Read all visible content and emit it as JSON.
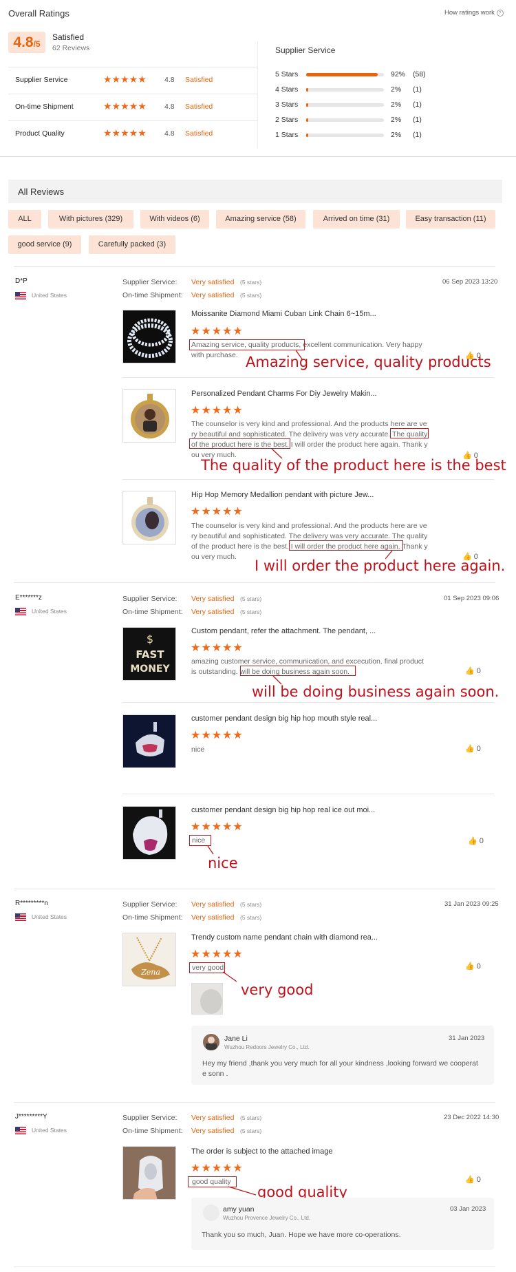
{
  "header": {
    "title": "Overall Ratings",
    "how_link": "How ratings work"
  },
  "overall": {
    "score": "4.8",
    "denom": "/5",
    "label": "Satisfied",
    "reviews": "62 Reviews"
  },
  "categories": [
    {
      "name": "Supplier Service",
      "score": "4.8",
      "label": "Satisfied"
    },
    {
      "name": "On-time Shipment",
      "score": "4.8",
      "label": "Satisfied"
    },
    {
      "name": "Product Quality",
      "score": "4.8",
      "label": "Satisfied"
    }
  ],
  "breakdown": {
    "title": "Supplier Service",
    "rows": [
      {
        "label": "5 Stars",
        "pct": "92%",
        "count": "(58)",
        "fill": 0.92
      },
      {
        "label": "4 Stars",
        "pct": "2%",
        "count": "(1)",
        "fill": 0.02
      },
      {
        "label": "3 Stars",
        "pct": "2%",
        "count": "(1)",
        "fill": 0.02
      },
      {
        "label": "2 Stars",
        "pct": "2%",
        "count": "(1)",
        "fill": 0.02
      },
      {
        "label": "1 Stars",
        "pct": "2%",
        "count": "(1)",
        "fill": 0.02
      }
    ]
  },
  "all_reviews": {
    "title": "All Reviews"
  },
  "filters": [
    "ALL",
    "With pictures (329)",
    "With videos (6)",
    "Amazing service (58)",
    "Arrived on time (31)",
    "Easy transaction (11)",
    "good service (9)",
    "Carefully packed (3)"
  ],
  "labels": {
    "supplier": "Supplier Service:",
    "ontime": "On-time Shipment:",
    "very_satisfied": "Very satisfied",
    "five_stars": "(5 stars)",
    "stars": "★★★★★"
  },
  "reviews": [
    {
      "user": "D*P",
      "country": "United States",
      "date": "06 Sep 2023 13:20"
    },
    {
      "user": "E*******z",
      "country": "United States",
      "date": "01 Sep 2023 09:06"
    },
    {
      "user": "R*********n",
      "country": "United States",
      "date": "31 Jan 2023 09:25"
    },
    {
      "user": "J*********Y",
      "country": "United States",
      "date": "23 Dec 2022 14:30"
    }
  ],
  "items": [
    {
      "title": "Moissanite Diamond Miami Cuban Link Chain 6~15m...",
      "text1": "Amazing service, quality products,",
      "text2": " excellent communication. Very happy",
      "text3": "with purchase.",
      "likes": "0"
    },
    {
      "title": "Personalized Pendant Charms For Diy Jewelry Makin...",
      "t1": "The counselor is very kind and professional. And the products here are ve",
      "t2": "ry beautiful and sophisticated. The delivery was very accurate.",
      "t2b": "The quality",
      "t3a": "of the product here is the best.",
      "t3b": " I will order the product here again. Thank y",
      "t4": "ou very much.",
      "likes": "0"
    },
    {
      "title": "Hip Hop Memory Medallion pendant with picture Jew...",
      "t1": "The counselor is very kind and professional. And the products here are ve",
      "t2": "ry beautiful and sophisticated. The delivery was very accurate. The quality",
      "t3a": "of the product here is the best.",
      "t3b": "I will order the product here again.",
      "t3c": " Thank y",
      "t4": "ou very much.",
      "likes": "0"
    },
    {
      "title": "Custom pendant, refer the attachment. The pendant, ...",
      "t1": "amazing customer service, communication, and excecution. final product",
      "t2a": "is outstanding.",
      "t2b": "will be doing business again soon.",
      "likes": "0"
    },
    {
      "title": "customer pendant design big hip hop mouth style real...",
      "t1": "nice",
      "likes": "0"
    },
    {
      "title": "customer pendant design big hip hop real ice out moi...",
      "t1": "nice",
      "likes": "0"
    },
    {
      "title": "Trendy custom name pendant chain with diamond rea...",
      "t1": "very good",
      "likes": "0"
    },
    {
      "title": "The order is subject to the attached image",
      "t1": "good quality",
      "likes": "0"
    }
  ],
  "replies": [
    {
      "name": "Jane Li",
      "company": "Wuzhou Redoors Jewelry Co., Ltd.",
      "date": "31 Jan 2023",
      "t1": "Hey my friend ,thank you very much for all your kindness ,looking forward we cooperat",
      "t2": "e sonn ."
    },
    {
      "name": "amy yuan",
      "company": "Wuzhou Provence Jewelry Co., Ltd.",
      "date": "03 Jan 2023",
      "t1": "Thank you so much, Juan.  Hope we have more co-operations."
    }
  ],
  "annotations": [
    "Amazing service, quality products",
    "The quality of the product here is the best",
    "I will order the product here again.",
    "will be doing business again soon.",
    "nice",
    "very good",
    "good quality"
  ],
  "colors": {
    "accent": "#e8650f",
    "tag_bg": "#fde3d6",
    "annotation": "#c0111a"
  }
}
